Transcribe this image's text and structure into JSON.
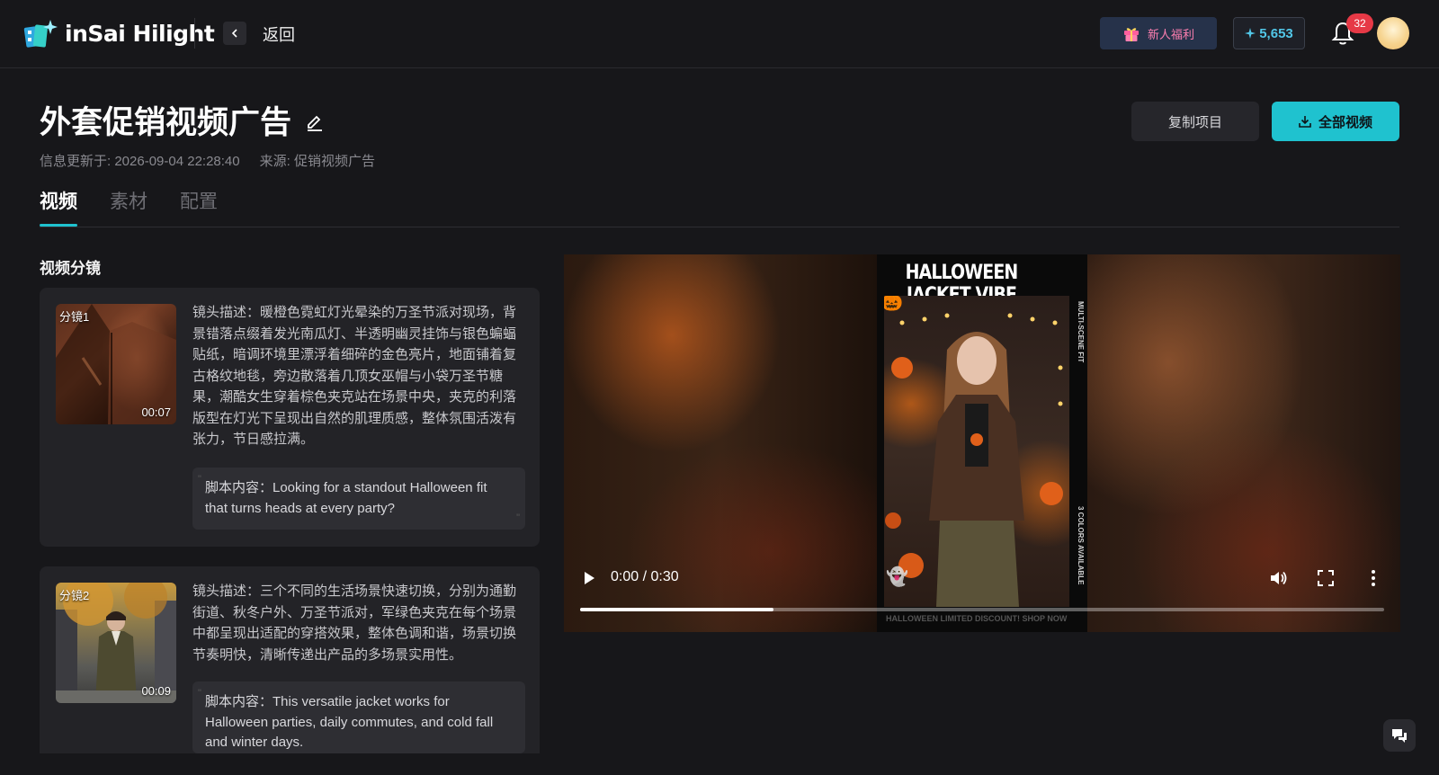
{
  "header": {
    "brand": "inSai Hilight",
    "back_label": "返回",
    "gift_label": "新人福利",
    "credits": "5,653",
    "notifications": "32"
  },
  "page": {
    "title": "外套促销视频广告",
    "updated": "信息更新于: 2026-09-04 22:28:40",
    "source": "来源: 促销视频广告",
    "copy_label": "复制项目",
    "download_label": "全部视频"
  },
  "tabs": [
    "视频",
    "素材",
    "配置"
  ],
  "section_title": "视频分镜",
  "shots": [
    {
      "tag": "分镜1",
      "duration": "00:07",
      "description": "镜头描述：暖橙色霓虹灯光晕染的万圣节派对现场，背景错落点缀着发光南瓜灯、半透明幽灵挂饰与银色蝙蝠贴纸，暗调环境里漂浮着细碎的金色亮片，地面铺着复古格纹地毯，旁边散落着几顶女巫帽与小袋万圣节糖果，潮酷女生穿着棕色夹克站在场景中央，夹克的利落版型在灯光下呈现出自然的肌理质感，整体氛围活泼有张力，节日感拉满。",
      "script": "脚本内容：Looking for a standout Halloween fit that turns heads at every party?"
    },
    {
      "tag": "分镜2",
      "duration": "00:09",
      "description": "镜头描述：三个不同的生活场景快速切换，分别为通勤街道、秋冬户外、万圣节派对，军绿色夹克在每个场景中都呈现出适配的穿搭效果，整体色调和谐，场景切换节奏明快，清晰传递出产品的多场景实用性。",
      "script": "脚本内容：This versatile jacket works for Halloween parties, daily commutes, and cold fall and winter days."
    }
  ],
  "video": {
    "poster_title": "HALLOWEEN JACKET VIBE",
    "side_top": "MULTI-SCENE FIT",
    "side_bottom": "3 COLORS AVAILABLE",
    "footer": "HALLOWEEN LIMITED DISCOUNT! SHOP NOW",
    "time": "0:00 / 0:30",
    "progress": 0.24
  },
  "colors": {
    "accent": "#1fc2cf",
    "badge": "#e63946",
    "credits": "#52c7e8"
  }
}
